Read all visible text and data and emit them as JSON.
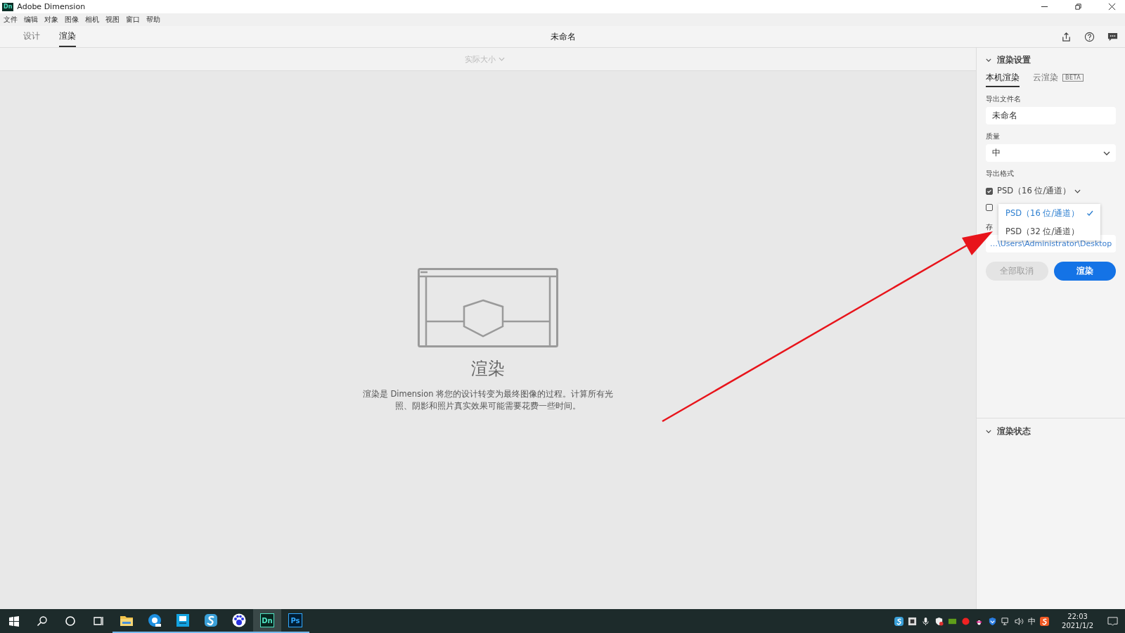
{
  "window": {
    "app_icon": "Dn",
    "title": "Adobe Dimension"
  },
  "menu": [
    "文件",
    "编辑",
    "对象",
    "图像",
    "相机",
    "视图",
    "窗口",
    "帮助"
  ],
  "mode_tabs": [
    {
      "label": "设计",
      "selected": false
    },
    {
      "label": "渲染",
      "selected": true
    }
  ],
  "document_title": "未命名",
  "canvas": {
    "zoom_dropdown": "实际大小",
    "empty_state": {
      "heading": "渲染",
      "description": "渲染是 Dimension 将您的设计转变为最终图像的过程。计算所有光照、阴影和照片真实效果可能需要花费一些时间。"
    }
  },
  "render_settings": {
    "title": "渲染设置",
    "tabs": [
      {
        "label": "本机渲染",
        "selected": true
      },
      {
        "label": "云渲染",
        "selected": false,
        "badge": "BETA"
      }
    ],
    "file_name": {
      "label": "导出文件名",
      "value": "未命名"
    },
    "quality": {
      "label": "质量",
      "value": "中"
    },
    "format": {
      "label": "导出格式",
      "rows": [
        {
          "label": "PSD（16 位/通道）",
          "checked": true
        },
        {
          "label": "",
          "checked": false
        }
      ],
      "dropdown": [
        {
          "label": "PSD（16 位/通道）",
          "selected": true
        },
        {
          "label": "PSD（32 位/通道）",
          "selected": false
        }
      ]
    },
    "storage": {
      "label": "存",
      "value": "…\\Users\\Administrator\\Desktop"
    },
    "buttons": [
      {
        "label": "全部取消",
        "kind": "secondary",
        "disabled": true
      },
      {
        "label": "渲染",
        "kind": "primary",
        "disabled": false
      }
    ]
  },
  "render_status": {
    "title": "渲染状态"
  },
  "annotation": {
    "kind": "arrow",
    "color": "#e8141b"
  },
  "taskbar": {
    "apps": [
      {
        "kind": "folder",
        "selected": false,
        "running": true
      },
      {
        "kind": "edge",
        "selected": false,
        "running": true
      },
      {
        "kind": "board",
        "selected": false,
        "running": true
      },
      {
        "kind": "s",
        "selected": false,
        "running": true
      },
      {
        "kind": "paw",
        "selected": false,
        "running": true
      },
      {
        "kind": "dn",
        "label": "Dn",
        "selected": true,
        "running": true
      },
      {
        "kind": "ps",
        "label": "Ps",
        "selected": false,
        "running": true
      }
    ],
    "ime": "中",
    "time": "22:03",
    "date": "2021/1/2"
  }
}
